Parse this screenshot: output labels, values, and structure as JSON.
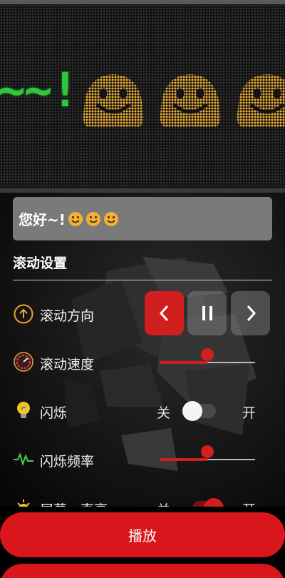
{
  "colors": {
    "accent": "#d11e1e",
    "led_text": "#2fc63a",
    "smiley": "#f2b134",
    "panel_bg": "#141414"
  },
  "led": {
    "scroll_text": "~~!"
  },
  "message": {
    "text": "您好~!"
  },
  "settings": {
    "title": "滚动设置",
    "direction": {
      "label": "滚动方向",
      "icon": "arrow-up-circle-icon",
      "left_icon": "chevron-left-icon",
      "pause_icon": "pause-icon",
      "right_icon": "chevron-right-icon",
      "selected": "left"
    },
    "speed": {
      "label": "滚动速度",
      "icon": "speedometer-icon",
      "value": 0.5
    },
    "blink": {
      "label": "闪烁",
      "icon": "lightbulb-icon",
      "off_label": "关",
      "on_label": "开",
      "enabled": false
    },
    "blink_freq": {
      "label": "闪烁频率",
      "icon": "waveform-icon",
      "value": 0.5
    },
    "screen_brightness": {
      "label": "屏幕一直亮",
      "icon": "sun-icon",
      "off_label": "关",
      "on_label": "开",
      "enabled": true
    }
  },
  "actions": {
    "play_label": "播放"
  }
}
